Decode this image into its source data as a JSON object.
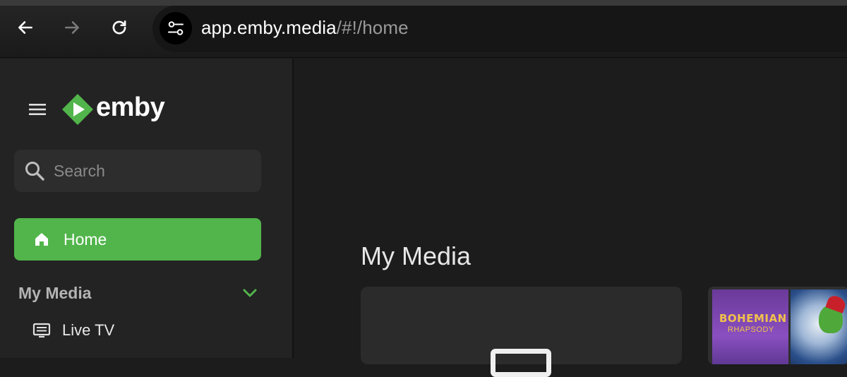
{
  "browser": {
    "url_host": "app.emby.media",
    "url_path": "/#!/home"
  },
  "sidebar": {
    "logo_text": "emby",
    "search_placeholder": "Search",
    "home_label": "Home",
    "section_title": "My Media",
    "items": [
      {
        "label": "Live TV",
        "icon": "live-tv-icon"
      }
    ]
  },
  "main": {
    "title": "My Media",
    "posters": [
      {
        "line1": "BOHEMIAN",
        "line2": "RHAPSODY"
      }
    ]
  },
  "colors": {
    "accent": "#52b54b",
    "sidebar_bg": "#232323",
    "main_bg": "#1c1c1c"
  }
}
